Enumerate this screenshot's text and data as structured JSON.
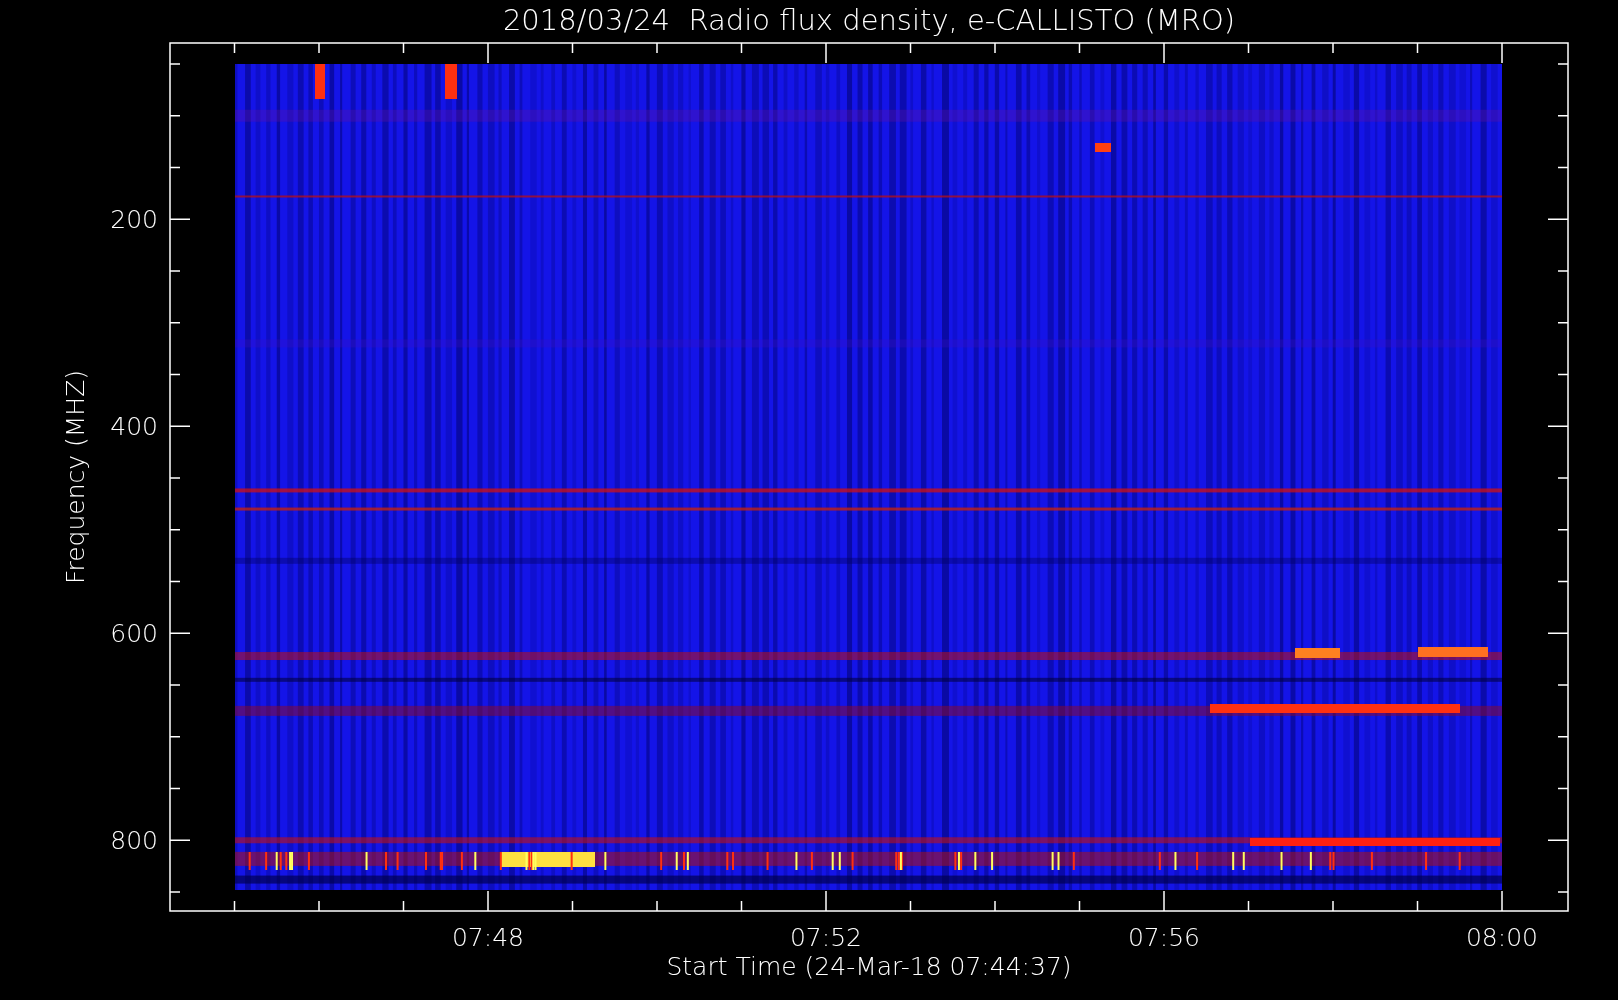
{
  "title": "2018/03/24  Radio flux density, e-CALLISTO (MRO)",
  "ylabel": "Frequency (MHZ)",
  "xlabel": "Start Time (24-Mar-18 07:44:37)",
  "yticks": [
    "200",
    "400",
    "600",
    "800"
  ],
  "xticks": [
    "07:48",
    "07:52",
    "07:56",
    "08:00"
  ]
}
